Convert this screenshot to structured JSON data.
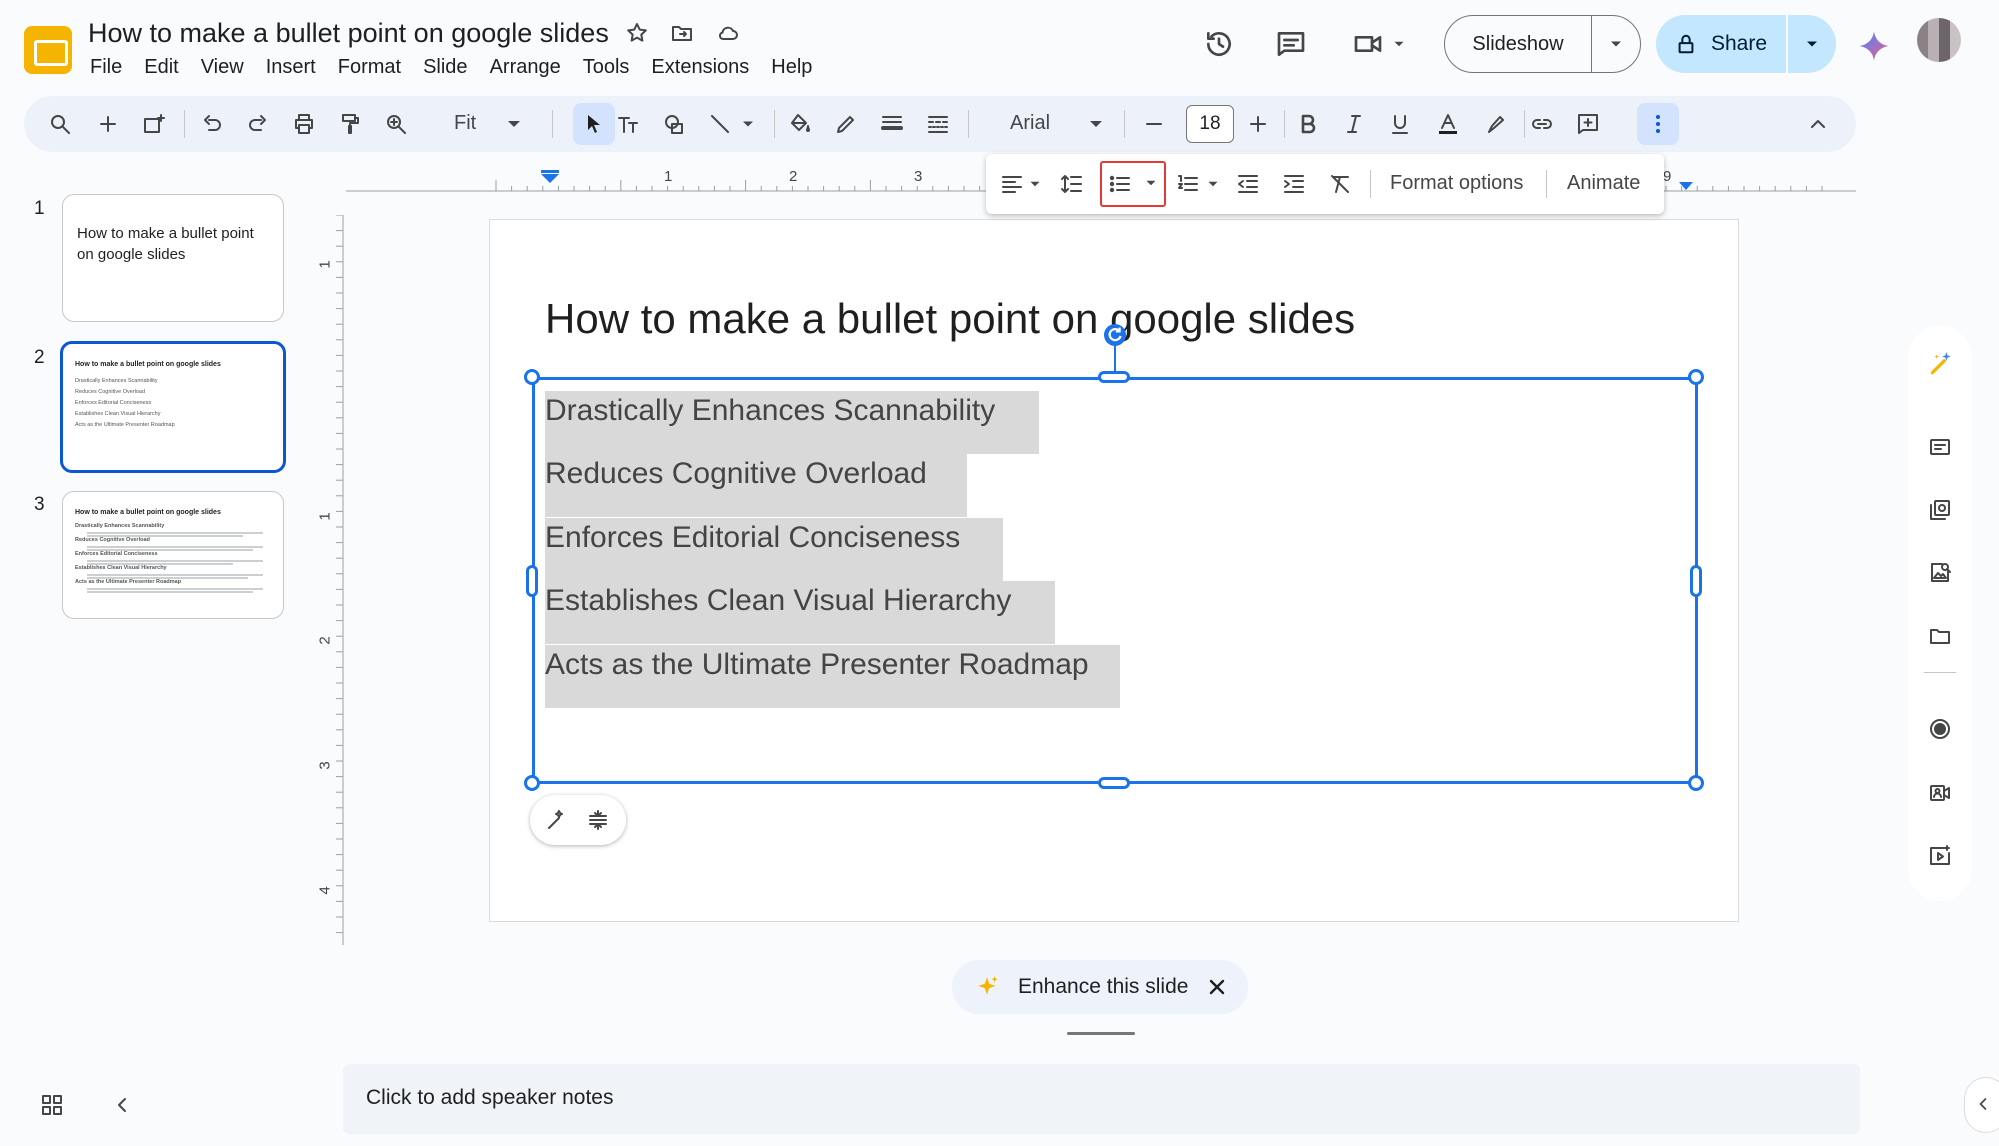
{
  "app": {
    "name": "Google Slides"
  },
  "doc": {
    "title": "How to make a bullet point on google slides"
  },
  "menu": [
    "File",
    "Edit",
    "View",
    "Insert",
    "Format",
    "Slide",
    "Arrange",
    "Tools",
    "Extensions",
    "Help"
  ],
  "header": {
    "slideshow_label": "Slideshow",
    "share_label": "Share"
  },
  "toolbar": {
    "zoom": "Fit",
    "font": "Arial",
    "font_size": "18"
  },
  "format_bar": {
    "format_options": "Format options",
    "animate": "Animate"
  },
  "ruler": {
    "h_ticks": [
      "1",
      "2",
      "3",
      "9"
    ],
    "v_ticks": [
      "1",
      "1",
      "2",
      "3",
      "4"
    ]
  },
  "slides": [
    {
      "number": "1",
      "title": "How to make a bullet point on google slides"
    },
    {
      "number": "2",
      "title": "How to make a bullet point on google slides",
      "lines": [
        "Drastically Enhances Scannability",
        "Reduces Cognitive Overload",
        "Enforces Editorial Conciseness",
        "Establishes Clean Visual Hierarchy",
        "Acts as the Ultimate Presenter Roadmap"
      ]
    },
    {
      "number": "3",
      "title": "How to make a bullet point on google slides",
      "lines": [
        "Drastically Enhances Scannability",
        "Reduces Cognitive Overload",
        "Enforces Editorial Conciseness",
        "Establishes Clean Visual Hierarchy",
        "Acts as the Ultimate Presenter Roadmap"
      ]
    }
  ],
  "canvas": {
    "title": "How to make a bullet point on google slides",
    "bullets": [
      "Drastically Enhances Scannability",
      "Reduces Cognitive Overload",
      "Enforces Editorial Conciseness",
      "Establishes Clean Visual Hierarchy",
      "Acts as the Ultimate Presenter Roadmap"
    ]
  },
  "enhance": {
    "label": "Enhance this slide"
  },
  "notes": {
    "placeholder": "Click to add speaker notes"
  },
  "colors": {
    "accent": "#1a73e8",
    "share_bg": "#c2e7ff",
    "highlight": "#e53935",
    "logo": "#f5b400"
  }
}
